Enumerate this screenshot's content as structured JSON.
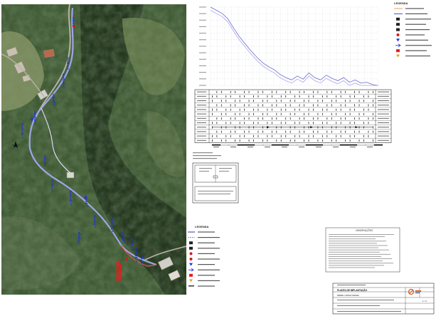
{
  "sheet": {
    "background": "#ffffff",
    "frame_color": "#000000"
  },
  "plan": {
    "photo_base_color": "#3f5a34",
    "route_color": "#9ea6e6",
    "route_alt_color": "#d8d8f4",
    "existing_route_color": "#e45454",
    "point_label_color": "#1c2ee6",
    "highlight_label_color": "#e81c1c",
    "north_arrow_icon": "north-arrow-icon",
    "legend": {
      "title": "LEGENDA",
      "items": [
        {
          "icon": "legend-line-icon",
          "color": "#2438b0"
        },
        {
          "icon": "legend-dashed-line-icon",
          "color": "#7a84d8"
        },
        {
          "icon": "legend-box-icon",
          "color": "#222222"
        },
        {
          "icon": "legend-box-icon",
          "color": "#222222"
        },
        {
          "icon": "legend-dot-icon",
          "color": "#d01c1c"
        },
        {
          "icon": "legend-dot-icon",
          "color": "#d01c1c"
        },
        {
          "icon": "legend-triangle-icon",
          "color": "#1c2ee6"
        },
        {
          "icon": "legend-arrow-icon",
          "color": "#1c2ee6"
        },
        {
          "icon": "legend-red-square-icon",
          "color": "#e02020"
        },
        {
          "icon": "legend-triangle-icon",
          "color": "#e6a020"
        },
        {
          "icon": "legend-text-icon",
          "color": "#333333"
        }
      ]
    }
  },
  "profile": {
    "grid_color": "#b8b8b8",
    "terrain_color": "#6a6ad0",
    "pipe_color": "#a8a8ec",
    "legend": {
      "title": "LEGENDA",
      "items": [
        {
          "icon": "legend-orange-line-icon",
          "color": "#e8a060"
        },
        {
          "icon": "legend-blue-line-icon",
          "color": "#4050c8"
        },
        {
          "icon": "legend-box-icon",
          "color": "#222222"
        },
        {
          "icon": "legend-box-icon",
          "color": "#222222"
        },
        {
          "icon": "legend-box-icon",
          "color": "#222222"
        },
        {
          "icon": "legend-dot-icon",
          "color": "#d01c1c"
        },
        {
          "icon": "legend-triangle-icon",
          "color": "#1c2ee6"
        },
        {
          "icon": "legend-arrow-icon",
          "color": "#1c2ee6"
        },
        {
          "icon": "legend-red-square-icon",
          "color": "#e02020"
        },
        {
          "icon": "legend-triangle-icon",
          "color": "#e6a020"
        }
      ]
    },
    "terrain_profile": [
      0.0,
      0.04,
      0.08,
      0.15,
      0.27,
      0.38,
      0.47,
      0.56,
      0.64,
      0.71,
      0.76,
      0.8,
      0.86,
      0.9,
      0.93,
      0.88,
      0.92,
      0.84,
      0.9,
      0.93,
      0.87,
      0.91,
      0.94,
      0.9,
      0.96,
      0.93,
      0.97,
      0.96,
      0.99,
      1.0
    ],
    "pipe_offset": 0.04
  },
  "detail_box": {
    "frame_color": "#000000"
  },
  "notes_box": {
    "title": "OBSERVAÇÕES",
    "text_color": "#555555"
  },
  "title_block": {
    "main_title": "PLANTA DE IMPLANTAÇÃO",
    "subtitle": "PERFIL LONGITUDINAL",
    "sheet_number": "1 / 4",
    "logo_primary_color": "#d25a1e",
    "logo_secondary_color": "#243a78"
  }
}
